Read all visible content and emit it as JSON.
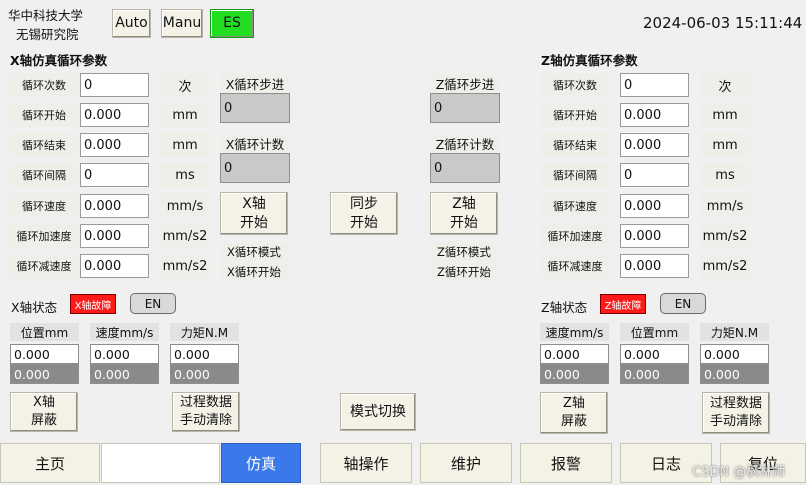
{
  "header": {
    "org_line1": "华中科技大学",
    "org_line2": "无锡研究院",
    "auto_label": "Auto",
    "manu_label": "Manu",
    "es_label": "ES",
    "es_color": "#22dd22",
    "datetime": "2024-06-03 15:11:44"
  },
  "x_params": {
    "title": "X轴仿真循环参数",
    "rows": [
      {
        "label": "循环次数",
        "value": "0",
        "unit": "次"
      },
      {
        "label": "循环开始",
        "value": "0.000",
        "unit": "mm"
      },
      {
        "label": "循环结束",
        "value": "0.000",
        "unit": "mm"
      },
      {
        "label": "循环间隔",
        "value": "0",
        "unit": "ms"
      },
      {
        "label": "循环速度",
        "value": "0.000",
        "unit": "mm/s"
      },
      {
        "label": "循环加速度",
        "value": "0.000",
        "unit": "mm/s2"
      },
      {
        "label": "循环减速度",
        "value": "0.000",
        "unit": "mm/s2"
      }
    ]
  },
  "z_params": {
    "title": "Z轴仿真循环参数",
    "rows": [
      {
        "label": "循环次数",
        "value": "0",
        "unit": "次"
      },
      {
        "label": "循环开始",
        "value": "0.000",
        "unit": "mm"
      },
      {
        "label": "循环结束",
        "value": "0.000",
        "unit": "mm"
      },
      {
        "label": "循环间隔",
        "value": "0",
        "unit": "ms"
      },
      {
        "label": "循环速度",
        "value": "0.000",
        "unit": "mm/s"
      },
      {
        "label": "循环加速度",
        "value": "0.000",
        "unit": "mm/s2"
      },
      {
        "label": "循环减速度",
        "value": "0.000",
        "unit": "mm/s2"
      }
    ]
  },
  "x_cycle": {
    "step_label": "X循环步进",
    "step_value": "0",
    "count_label": "X循环计数",
    "count_value": "0",
    "start_button": "X轴\n开始",
    "mode_label": "X循环模式",
    "start_label": "X循环开始"
  },
  "z_cycle": {
    "step_label": "Z循环步进",
    "step_value": "0",
    "count_label": "Z循环计数",
    "count_value": "0",
    "start_button": "Z轴\n开始",
    "mode_label": "Z循环模式",
    "start_label": "Z循环开始"
  },
  "sync_button": "同步\n开始",
  "x_status": {
    "label": "X轴状态",
    "fault": "X轴故障",
    "fault_color": "#ff1a1a",
    "en": "EN",
    "columns": [
      {
        "header": "位置mm",
        "v1": "0.000",
        "v2": "0.000"
      },
      {
        "header": "速度mm/s",
        "v1": "0.000",
        "v2": "0.000"
      },
      {
        "header": "力矩N.M",
        "v1": "0.000",
        "v2": "0.000"
      }
    ],
    "mask_button": "X轴\n屏蔽",
    "clear_button": "过程数据\n手动清除"
  },
  "z_status": {
    "label": "Z轴状态",
    "fault": "Z轴故障",
    "en": "EN",
    "columns": [
      {
        "header": "速度mm/s",
        "v1": "0.000",
        "v2": "0.000"
      },
      {
        "header": "位置mm",
        "v1": "0.000",
        "v2": "0.000"
      },
      {
        "header": "力矩N.M",
        "v1": "0.000",
        "v2": "0.000"
      }
    ],
    "mask_button": "Z轴\n屏蔽",
    "clear_button": "过程数据\n手动清除"
  },
  "mode_switch": "模式切换",
  "tabs": [
    "主页",
    "仿真",
    "轴操作",
    "维护",
    "报警",
    "日志",
    "复位"
  ],
  "active_tab_color": "#3b78ea",
  "watermark": "CSDN @枫林师"
}
